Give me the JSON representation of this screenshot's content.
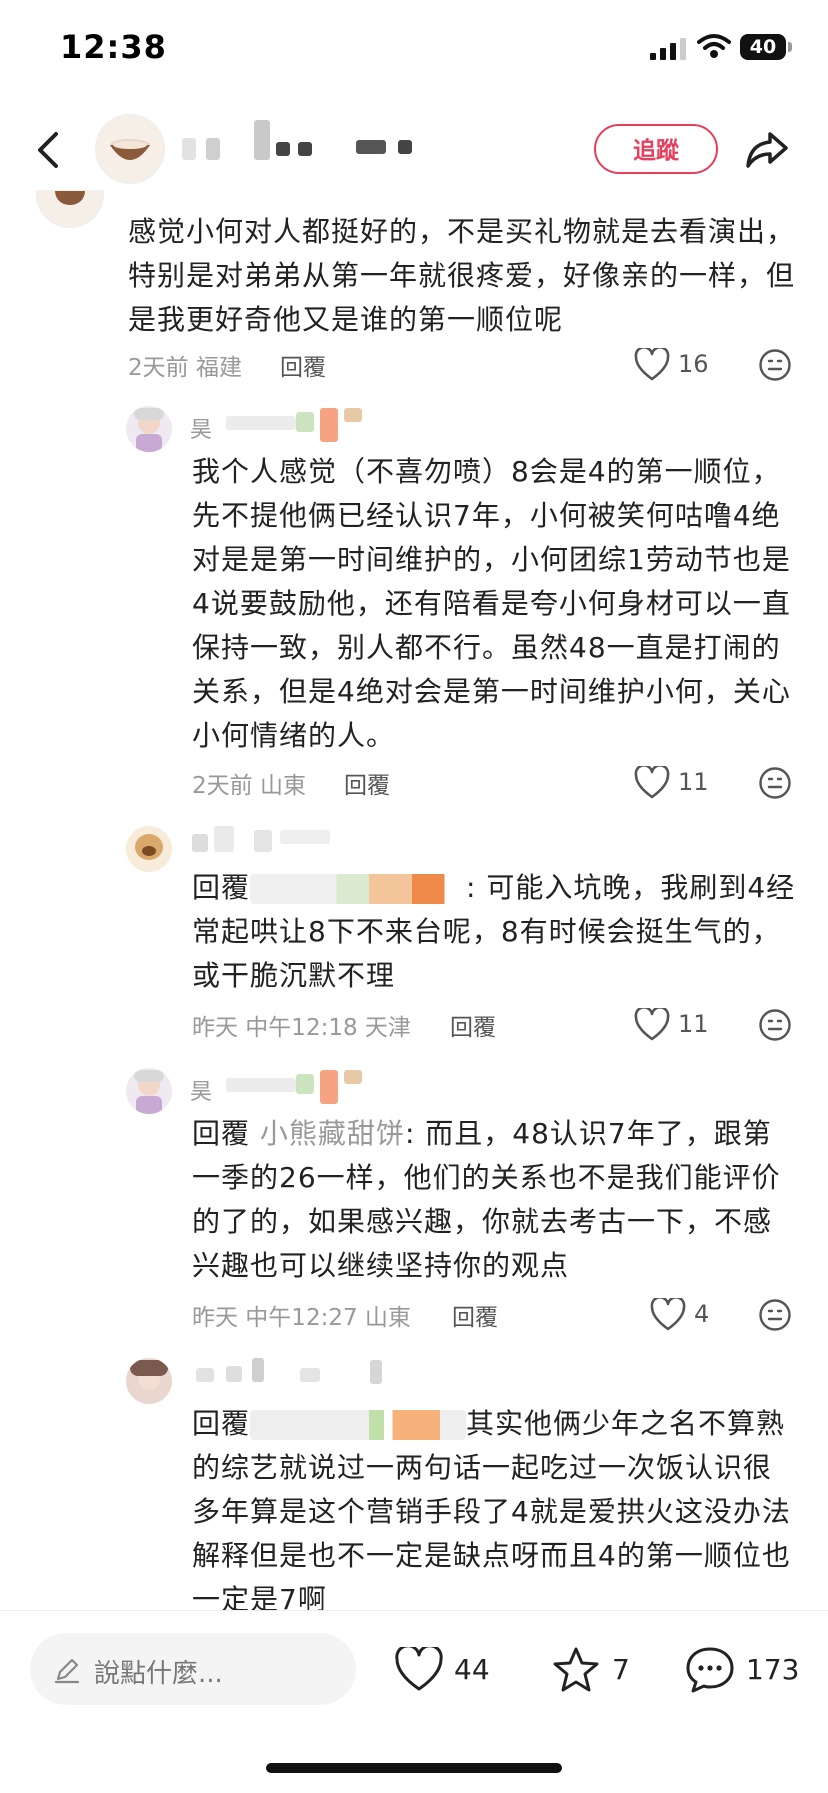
{
  "status": {
    "time": "12:38",
    "battery": "40"
  },
  "header": {
    "follow_label": "追蹤"
  },
  "comments": [
    {
      "text": "感觉小何对人都挺好的，不是买礼物就是去看演出，特别是对弟弟从第一年就很疼爱，好像亲的一样，但是我更好奇他又是谁的第一顺位呢",
      "meta": "2天前 福建",
      "reply": "回覆",
      "likes": "16"
    },
    {
      "name": "昊",
      "text": "我个人感觉（不喜勿喷）8会是4的第一顺位，先不提他俩已经认识7年，小何被笑何咕噜4绝对是是第一时间维护的，小何团综1劳动节也是4说要鼓励他，还有陪看是夸小何身材可以一直保持一致，别人都不行。虽然48一直是打闹的关系，但是4绝对会是第一时间维护小何，关心小何情绪的人。",
      "meta": "2天前 山東",
      "reply": "回覆",
      "likes": "11"
    },
    {
      "reply_prefix": "回覆",
      "text": ": 可能入坑晚，我刷到4经常起哄让8下不来台呢，8有时候会挺生气的，或干脆沉默不理",
      "meta": "昨天 中午12:18 天津",
      "reply": "回覆",
      "likes": "11"
    },
    {
      "name": "昊",
      "reply_prefix": "回覆",
      "mention": "小熊藏甜饼",
      "text": ": 而且，48认识7年了，跟第一季的26一样，他们的关系也不是我们能评价的了的，如果感兴趣，你就去考古一下，不感兴趣也可以继续坚持你的观点",
      "meta": "昨天 中午12:27 山東",
      "reply": "回覆",
      "likes": "4"
    },
    {
      "reply_prefix": "回覆",
      "text": "其实他俩少年之名不算熟的综艺就说过一两句话一起吃过一次饭认识很多年算是这个营销手段了4就是爱拱火这没办法解释但是也不一定是缺点呀而且4的第一顺位也一定是7啊"
    }
  ],
  "bottom_bar": {
    "input_placeholder": "說點什麼...",
    "likes": "44",
    "favorites": "7",
    "comments": "173"
  },
  "colors": {
    "accent": "#e63e5c",
    "muted": "#999999"
  },
  "icons": [
    "back-arrow-icon",
    "share-icon",
    "heart-icon",
    "smiley-icon",
    "pencil-icon",
    "star-icon",
    "chat-bubble-icon"
  ]
}
